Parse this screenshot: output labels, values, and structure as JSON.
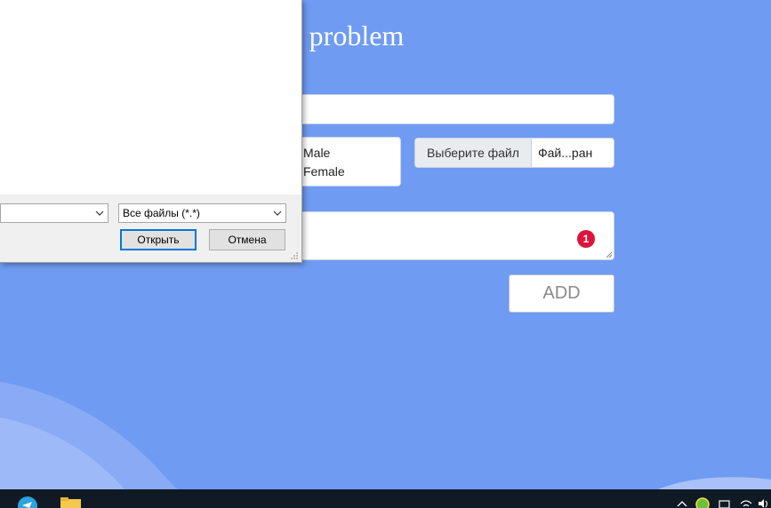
{
  "page": {
    "title": "r problem",
    "background_color": "#6f9bf2"
  },
  "form": {
    "name_value": "",
    "gender_options": [
      "Male",
      "Female"
    ],
    "file_button_label": "Выберите файл",
    "file_name": "Фай...ран",
    "description_value": "",
    "error_badge": "1",
    "add_button_label": "ADD"
  },
  "dialog": {
    "file_type_selected": "Все файлы (*.*)",
    "open_button_label": "Открыть",
    "cancel_button_label": "Отмена",
    "file_name_value": ""
  },
  "taskbar": {
    "icons": [
      "telegram-icon",
      "folder-icon",
      "chevron-up-icon",
      "green-app-icon",
      "battery-icon",
      "wifi-icon",
      "speaker-icon"
    ]
  }
}
